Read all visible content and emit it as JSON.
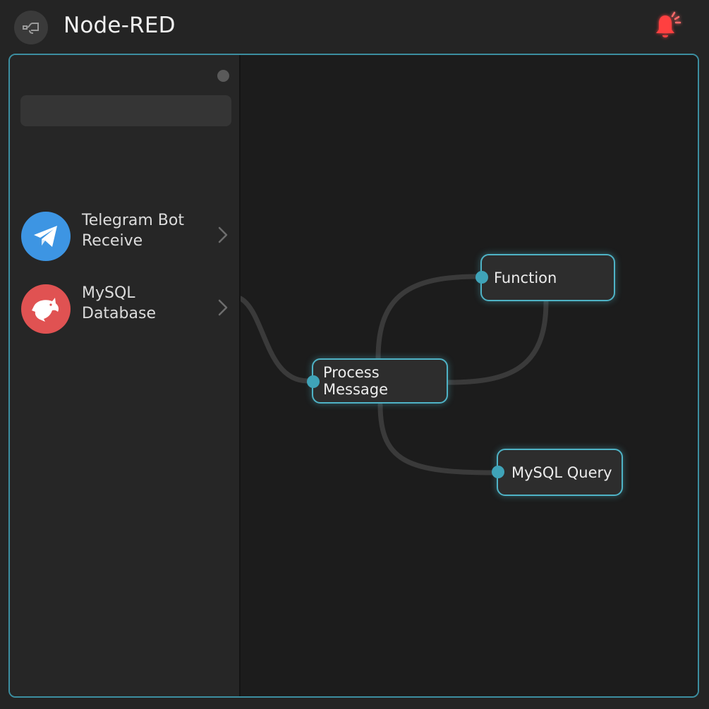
{
  "app": {
    "title": "Node-RED"
  },
  "palette": {
    "items": [
      {
        "label_line1": "Telegram Bot",
        "label_line2": "Receive",
        "icon": "telegram-icon",
        "color": "#3d95e3"
      },
      {
        "label_line1": "MySQL",
        "label_line2": "Database",
        "icon": "dolphin-icon",
        "color": "#e05252"
      }
    ]
  },
  "flow": {
    "nodes": {
      "process": {
        "label": "Process Message"
      },
      "function": {
        "label": "Function"
      },
      "mysql_query": {
        "label": "MySQL Query"
      }
    }
  },
  "notifications": {
    "icon": "bell-icon",
    "color": "#ff3b3b"
  },
  "theme": {
    "accent": "#4fb3c6",
    "port": "#3fa3b8"
  }
}
